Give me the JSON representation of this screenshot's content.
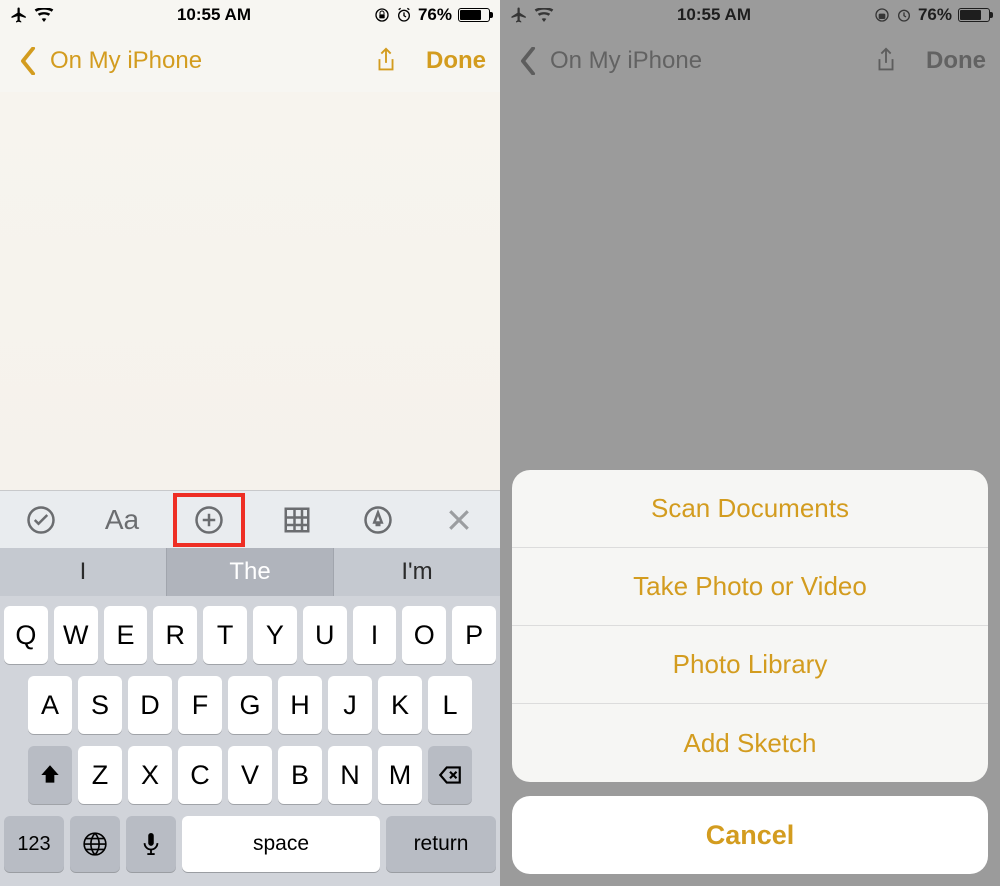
{
  "status": {
    "time": "10:55 AM",
    "battery_pct": "76%",
    "icons_left": [
      "airplane-mode-icon",
      "wifi-icon"
    ],
    "icons_right": [
      "orientation-lock-icon",
      "alarm-icon"
    ]
  },
  "nav": {
    "back_label": "On My iPhone",
    "done_label": "Done",
    "share_icon": "share-icon"
  },
  "toolbar": {
    "items": [
      "checklist-icon",
      "text-format",
      "add-attachment-icon",
      "table-icon",
      "markup-icon",
      "close-icon"
    ],
    "text_format_label": "Aa",
    "highlighted_index": 2
  },
  "suggestions": [
    "I",
    "The",
    "I'm"
  ],
  "keyboard": {
    "row1": [
      "Q",
      "W",
      "E",
      "R",
      "T",
      "Y",
      "U",
      "I",
      "O",
      "P"
    ],
    "row2": [
      "A",
      "S",
      "D",
      "F",
      "G",
      "H",
      "J",
      "K",
      "L"
    ],
    "row3": [
      "Z",
      "X",
      "C",
      "V",
      "B",
      "N",
      "M"
    ],
    "key_123": "123",
    "key_space": "space",
    "key_return": "return"
  },
  "action_sheet": {
    "items": [
      "Scan Documents",
      "Take Photo or Video",
      "Photo Library",
      "Add Sketch"
    ],
    "cancel": "Cancel"
  }
}
